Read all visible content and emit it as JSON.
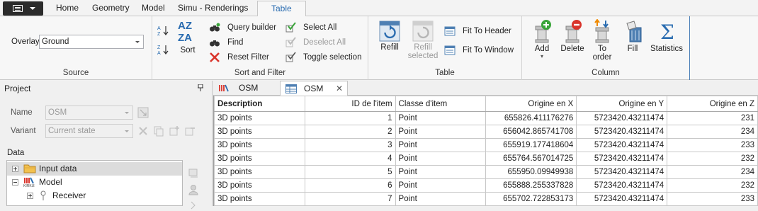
{
  "ribbon_tabs": [
    "Home",
    "Geometry",
    "Model",
    "Simu - Renderings",
    "Table"
  ],
  "active_tab": "Table",
  "source_group": {
    "label": "Source",
    "overlay_label": "Overlay",
    "overlay_value": "Ground"
  },
  "sort_filter_group": {
    "label": "Sort and Filter",
    "sort_label": "Sort",
    "sort_az": "A Z",
    "sort_za": "Z A",
    "query_builder": "Query builder",
    "find": "Find",
    "reset_filter": "Reset Filter",
    "select_all": "Select All",
    "deselect_all": "Deselect All",
    "toggle_selection": "Toggle selection"
  },
  "table_group": {
    "label": "Table",
    "refill": "Refill",
    "refill_selected": [
      "Refill",
      "selected"
    ],
    "fit_to_header": "Fit To Header",
    "fit_to_window": "Fit To Window"
  },
  "column_group": {
    "label": "Column",
    "add": "Add",
    "delete": "Delete",
    "to_order": [
      "To",
      "order"
    ],
    "fill": "Fill",
    "statistics": "Statistics"
  },
  "project_panel": {
    "title": "Project",
    "name_label": "Name",
    "name_value": "OSM",
    "variant_label": "Variant",
    "variant_value": "Current state",
    "data_label": "Data",
    "tree": [
      {
        "label": "Input data",
        "icon": "folder-icon",
        "selected": true
      },
      {
        "label": "Model",
        "icon": "model-icon",
        "selected": false
      },
      {
        "label": "Receiver",
        "icon": "receiver-icon",
        "selected": false
      }
    ]
  },
  "doc_tabs": [
    {
      "label": "OSM",
      "icon": "map-icon",
      "active": false
    },
    {
      "label": "OSM",
      "icon": "table-icon",
      "active": true,
      "close": "✕"
    }
  ],
  "table": {
    "columns": [
      "Description",
      "ID de l'item",
      "Classe d'item",
      "Origine en X",
      "Origine en Y",
      "Origine en Z"
    ],
    "rows": [
      [
        "3D points",
        "1",
        "Point",
        "655826.411176276",
        "5723420.43211474",
        "231"
      ],
      [
        "3D points",
        "2",
        "Point",
        "656042.865741708",
        "5723420.43211474",
        "234"
      ],
      [
        "3D points",
        "3",
        "Point",
        "655919.177418604",
        "5723420.43211474",
        "233"
      ],
      [
        "3D points",
        "4",
        "Point",
        "655764.567014725",
        "5723420.43211474",
        "232"
      ],
      [
        "3D points",
        "5",
        "Point",
        "655950.09949938",
        "5723420.43211474",
        "234"
      ],
      [
        "3D points",
        "6",
        "Point",
        "655888.255337828",
        "5723420.43211474",
        "232"
      ],
      [
        "3D points",
        "7",
        "Point",
        "655702.722853173",
        "5723420.43211474",
        "233"
      ]
    ]
  },
  "colors": {
    "accent": "#2a6cb0",
    "delete_red": "#d9342b",
    "add_green": "#3aa53a",
    "disabled": "#9a9a9a"
  }
}
